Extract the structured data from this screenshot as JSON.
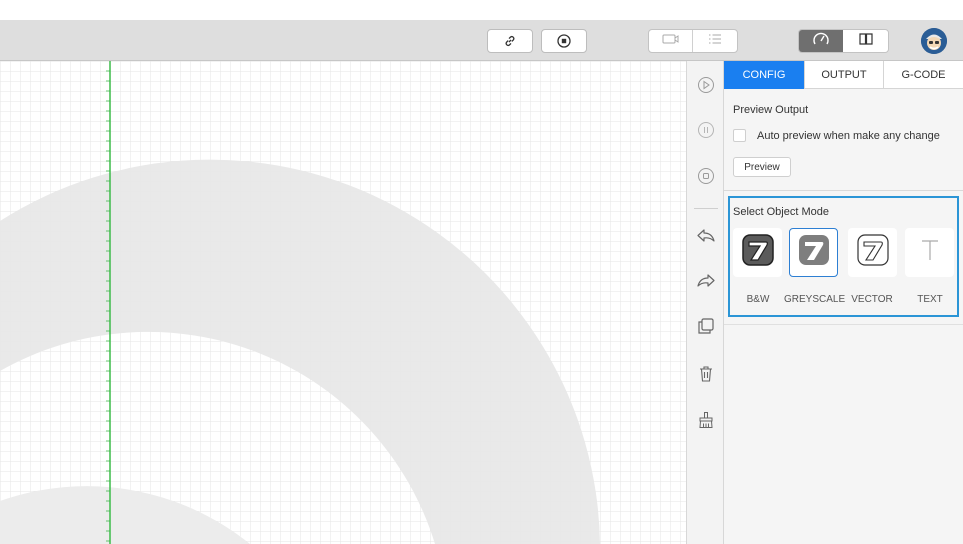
{
  "toolbar": {
    "link_icon": "link-icon",
    "record_icon": "record-stop-icon",
    "camera_icon": "camera-icon",
    "list_icon": "list-icon",
    "speed_icon": "speedometer-icon",
    "book_icon": "book-icon",
    "avatar_icon": "user-avatar"
  },
  "tools": [
    {
      "name": "play-icon"
    },
    {
      "name": "pause-icon"
    },
    {
      "name": "stop-icon"
    },
    {
      "name": "undo-icon"
    },
    {
      "name": "redo-icon"
    },
    {
      "name": "duplicate-icon"
    },
    {
      "name": "trash-icon"
    },
    {
      "name": "clear-brush-icon"
    }
  ],
  "panel": {
    "tabs": [
      "CONFIG",
      "OUTPUT",
      "G-CODE"
    ],
    "active_tab": "CONFIG",
    "preview_output_label": "Preview Output",
    "auto_preview_label": "Auto preview when make any change",
    "auto_preview_checked": false,
    "preview_button": "Preview",
    "select_mode_label": "Select Object Mode",
    "modes": [
      "B&W",
      "GREYSCALE",
      "VECTOR",
      "TEXT"
    ],
    "selected_mode": "GREYSCALE"
  },
  "colors": {
    "accent": "#1a7ff0",
    "mode_border": "#2b95d6",
    "axis_green": "#3dbb4a",
    "grid_line": "#e3e3e3",
    "shape_fill": "#ececec"
  }
}
